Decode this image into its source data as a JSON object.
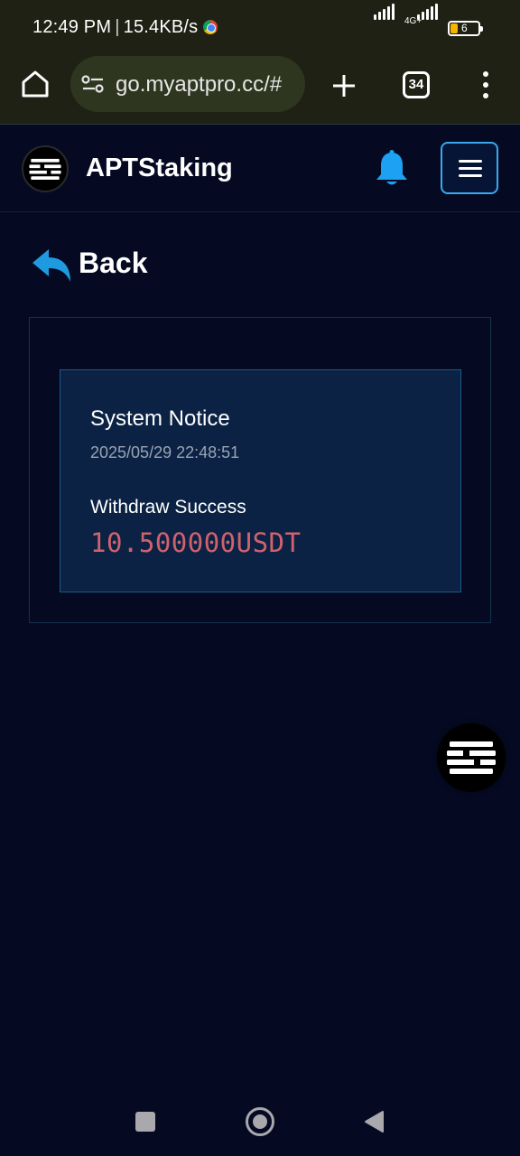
{
  "status_bar": {
    "time": "12:49 PM",
    "speed": "15.4KB/s",
    "network": "4G+",
    "battery": "6"
  },
  "browser": {
    "url": "go.myaptpro.cc/#",
    "tab_count": "34"
  },
  "header": {
    "title": "APTStaking"
  },
  "back": {
    "label": "Back"
  },
  "notice": {
    "title": "System Notice",
    "timestamp": "2025/05/29 22:48:51",
    "message": "Withdraw Success",
    "amount": "10.500000USDT"
  },
  "colors": {
    "background": "#050a22",
    "accent_blue": "#3aa8ee",
    "amount_red": "#d0626e",
    "card_bg": "#0b2244"
  },
  "icons": {
    "bell": "bell-icon",
    "menu": "hamburger-icon",
    "back": "back-arrow-icon",
    "logo": "aptos-logo-icon"
  }
}
